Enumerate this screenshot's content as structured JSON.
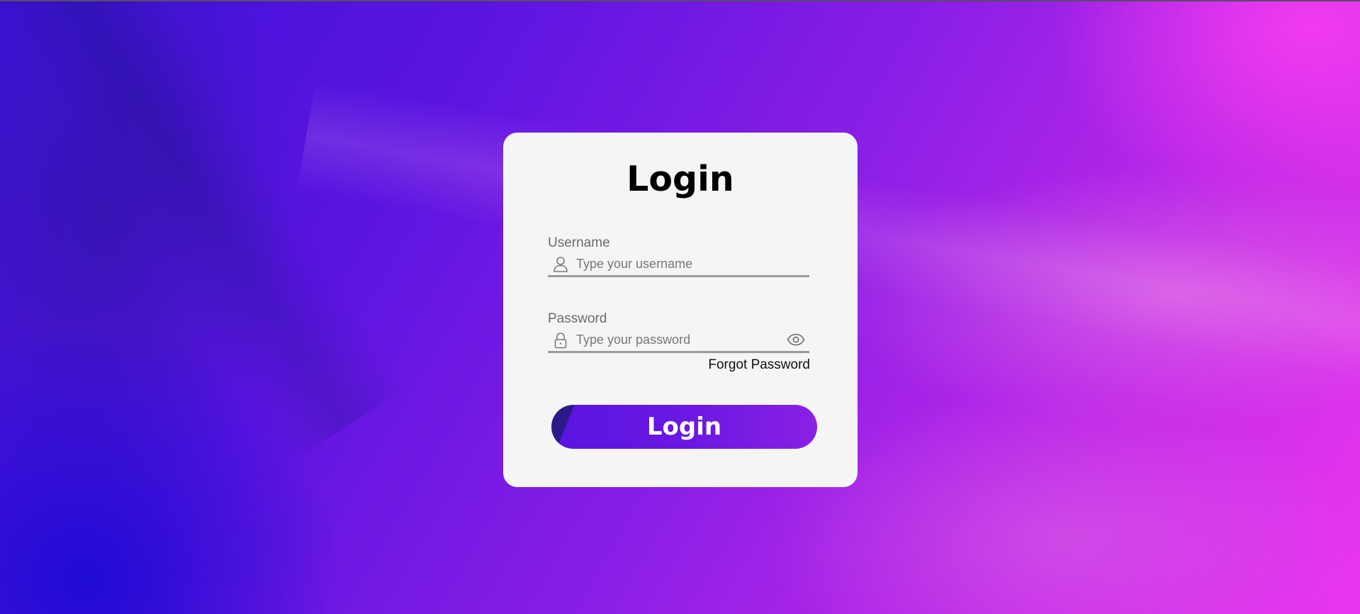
{
  "form": {
    "title": "Login",
    "username": {
      "label": "Username",
      "placeholder": "Type your username",
      "value": "",
      "icon": "user-icon"
    },
    "password": {
      "label": "Password",
      "placeholder": "Type your password",
      "value": "",
      "icon": "lock-icon",
      "toggle_icon": "eye-icon"
    },
    "forgot_password": "Forgot Password",
    "submit_label": "Login"
  },
  "colors": {
    "card_background": "#f5f5f5",
    "button_gradient_start": "#5a14e0",
    "button_gradient_end": "#8a20e4",
    "field_underline": "#9a9a9a"
  }
}
